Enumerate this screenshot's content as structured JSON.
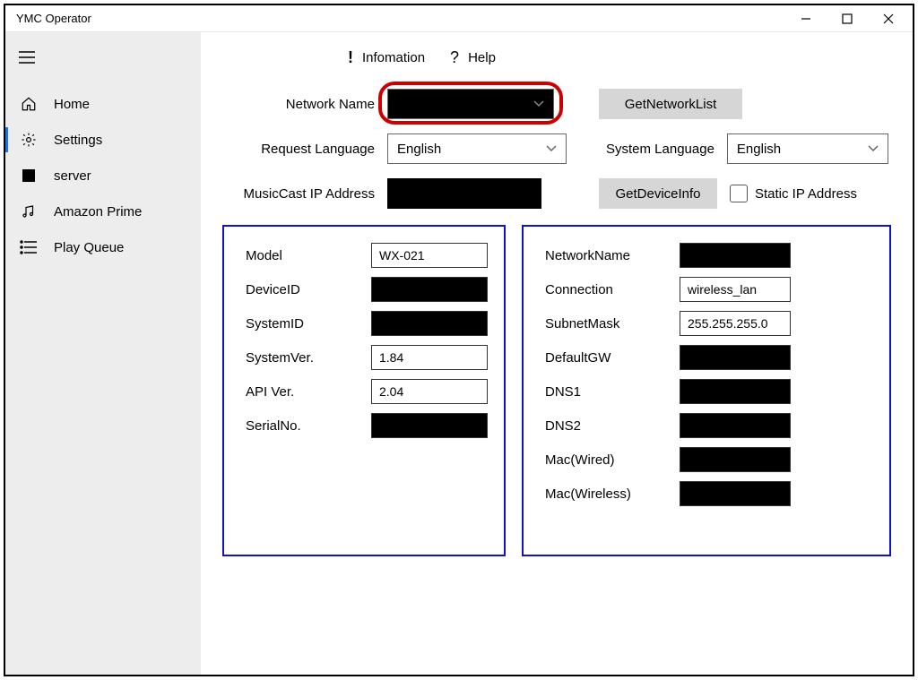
{
  "window": {
    "title": "YMC Operator"
  },
  "sidebar": {
    "items": [
      {
        "label": "Home"
      },
      {
        "label": "Settings"
      },
      {
        "label": "server"
      },
      {
        "label": "Amazon Prime"
      },
      {
        "label": "Play Queue"
      }
    ]
  },
  "tabs": {
    "info": "Infomation",
    "help": "Help"
  },
  "form": {
    "network_name_label": "Network Name",
    "get_network_list": "GetNetworkList",
    "request_language_label": "Request Language",
    "request_language_value": "English",
    "system_language_label": "System Language",
    "system_language_value": "English",
    "ip_label": "MusicCast IP Address",
    "get_device_info": "GetDeviceInfo",
    "static_ip_label": "Static IP Address"
  },
  "leftPanel": {
    "model_label": "Model",
    "model_value": "WX-021",
    "deviceid_label": "DeviceID",
    "systemid_label": "SystemID",
    "systemver_label": "SystemVer.",
    "systemver_value": "1.84",
    "apiver_label": "API Ver.",
    "apiver_value": "2.04",
    "serialno_label": "SerialNo."
  },
  "rightPanel": {
    "networkname_label": "NetworkName",
    "connection_label": "Connection",
    "connection_value": "wireless_lan",
    "subnet_label": "SubnetMask",
    "subnet_value": "255.255.255.0",
    "defaultgw_label": "DefaultGW",
    "dns1_label": "DNS1",
    "dns2_label": "DNS2",
    "macwired_label": "Mac(Wired)",
    "macwireless_label": "Mac(Wireless)"
  }
}
